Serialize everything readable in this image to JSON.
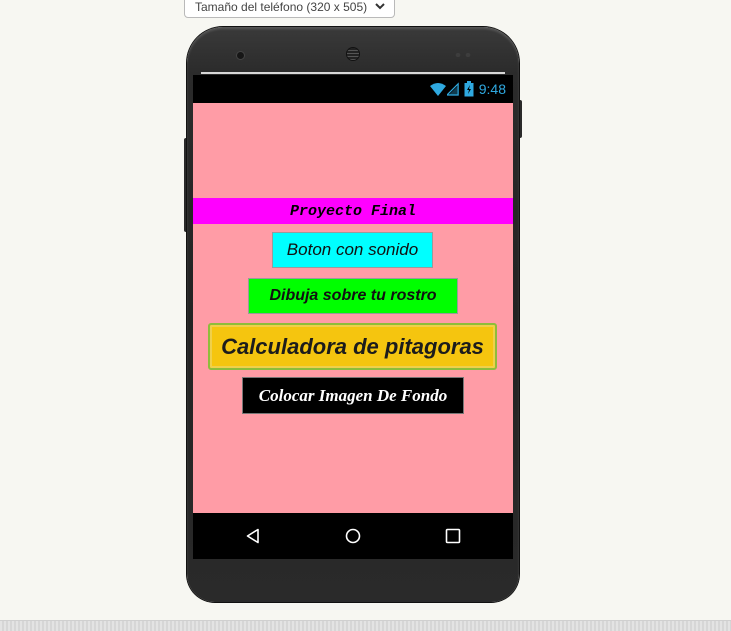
{
  "designer": {
    "device_size_select": "Tamaño del teléfono (320 x 505)"
  },
  "status_bar": {
    "time": "9:48",
    "icons": [
      "wifi-icon",
      "signal-icon",
      "battery-charging-icon"
    ]
  },
  "screen": {
    "background": "#ff9ca6",
    "title": "Proyecto Final",
    "buttons": [
      {
        "label": "Boton con sonido",
        "color": "#00ffff"
      },
      {
        "label": "Dibuja sobre tu rostro",
        "color": "#00ff00"
      },
      {
        "label": "Calculadora de pitagoras",
        "color": "#f5c50f"
      },
      {
        "label": "Colocar Imagen De Fondo",
        "color": "#000000"
      }
    ]
  },
  "nav_bar": {
    "icons": [
      "back-icon",
      "home-icon",
      "recents-icon"
    ]
  },
  "colors": {
    "status_time": "#2fa9e0",
    "title_bar": "#ff00ff"
  }
}
